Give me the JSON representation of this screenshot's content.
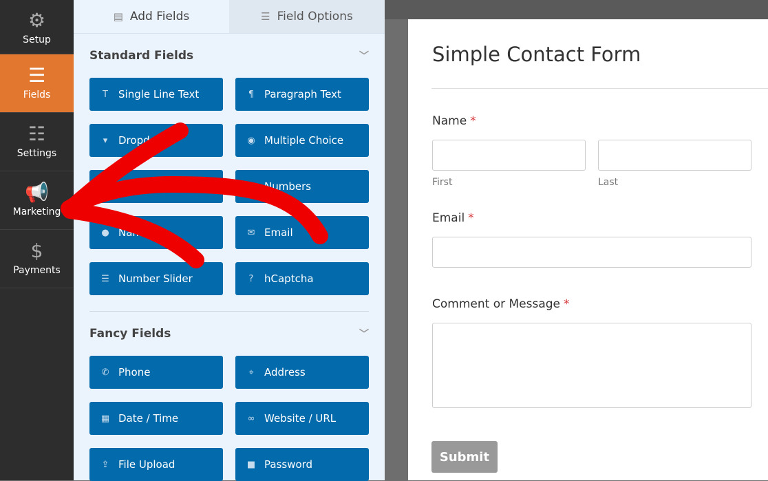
{
  "sidebar": {
    "items": [
      {
        "label": "Setup",
        "icon": "gear-icon",
        "glyph": "⚙"
      },
      {
        "label": "Fields",
        "icon": "list-icon",
        "glyph": "☰",
        "active": true
      },
      {
        "label": "Settings",
        "icon": "sliders-icon",
        "glyph": "☷"
      },
      {
        "label": "Marketing",
        "icon": "megaphone-icon",
        "glyph": "📢"
      },
      {
        "label": "Payments",
        "icon": "dollar-icon",
        "glyph": "$"
      }
    ]
  },
  "tabs": [
    {
      "label": "Add Fields",
      "glyph": "▤"
    },
    {
      "label": "Field Options",
      "glyph": "☰"
    }
  ],
  "standard": {
    "title": "Standard Fields",
    "fields": [
      {
        "label": "Single Line Text",
        "glyph": "T"
      },
      {
        "label": "Paragraph Text",
        "glyph": "¶"
      },
      {
        "label": "Dropdown",
        "glyph": "▾"
      },
      {
        "label": "Multiple Choice",
        "glyph": "◉"
      },
      {
        "label": "Checkboxes",
        "glyph": "☑"
      },
      {
        "label": "Numbers",
        "glyph": "#"
      },
      {
        "label": "Name",
        "glyph": "●"
      },
      {
        "label": "Email",
        "glyph": "✉"
      },
      {
        "label": "Number Slider",
        "glyph": "☰"
      },
      {
        "label": "hCaptcha",
        "glyph": "?"
      }
    ]
  },
  "fancy": {
    "title": "Fancy Fields",
    "fields": [
      {
        "label": "Phone",
        "glyph": "✆"
      },
      {
        "label": "Address",
        "glyph": "⌖"
      },
      {
        "label": "Date / Time",
        "glyph": "▦"
      },
      {
        "label": "Website / URL",
        "glyph": "∞"
      },
      {
        "label": "File Upload",
        "glyph": "⇪"
      },
      {
        "label": "Password",
        "glyph": "■"
      }
    ]
  },
  "form": {
    "title": "Simple Contact Form",
    "name_label": "Name",
    "first": "First",
    "last": "Last",
    "email_label": "Email",
    "message_label": "Comment or Message",
    "required": "*",
    "submit": "Submit"
  },
  "colors": {
    "accent": "#e27730",
    "button": "#036aab",
    "arrow": "#ee0000"
  }
}
